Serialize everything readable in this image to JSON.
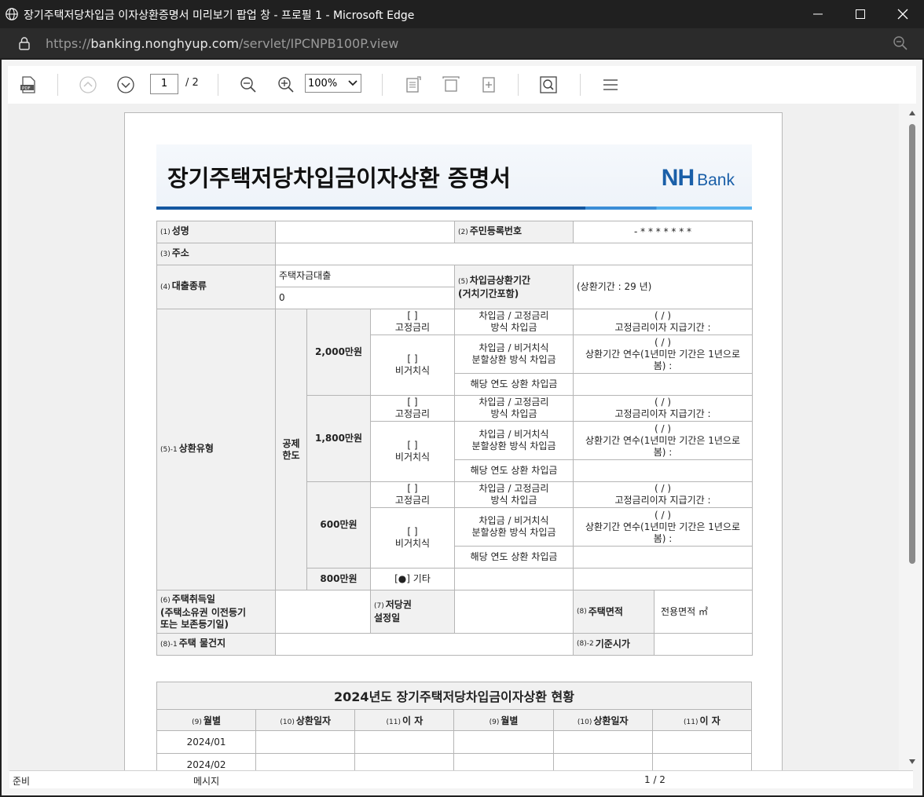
{
  "window": {
    "title": "장기주택저당차입금 이자상환증명서 미리보기 팝업 창 - 프로필 1 - Microsoft Edge",
    "url_prefix": "https://",
    "url_host": "banking.nonghyup.com",
    "url_path": "/servlet/IPCNPB100P.view"
  },
  "toolbar": {
    "page_current": "1",
    "page_total": "/ 2",
    "zoom": "100%"
  },
  "document": {
    "title": "장기주택저당차입금이자상환 증명서",
    "logo_nh": "NH",
    "logo_bank": "Bank",
    "n1": "(1)",
    "name_label": "성명",
    "n2": "(2)",
    "ssn_label": "주민등록번호",
    "ssn_value": "- * * * * * * *",
    "n3": "(3)",
    "addr_label": "주소",
    "n4": "(4)",
    "loan_type_label": "대출종류",
    "loan_type_value": "주택자금대출",
    "loan_type_value2": "0",
    "n5": "(5)",
    "period_label_1": "차입금상환기간",
    "period_label_2": "(거치기간포함)",
    "period_value": "(상환기간 : 29  년)",
    "n51": "(5)-1",
    "repay_type_label": "상환유형",
    "deduct_1": "공제",
    "deduct_2": "한도",
    "limits": [
      "2,000만원",
      "1,800만원",
      "600만원",
      "800만원"
    ],
    "bracket": "[ ]",
    "fixed": "고정금리",
    "nongrace": "비거치식",
    "fixed_desc_1": "차입금 / 고정금리",
    "fixed_desc_2": "방식 차입금",
    "nongrace_desc_1": "차입금 / 비거치식",
    "nongrace_desc_2": "분할상환 방식 차입금",
    "year_repay": "해당 연도 상환 차입금",
    "slash": "( / )",
    "fixed_period": "고정금리이자 지급기간 :",
    "nongrace_years_1": "상환기간 연수(1년미만 기간은 1년으로",
    "nongrace_years_2": "봄) :",
    "etc": "[●] 기타",
    "n6": "(6)",
    "acq_label_1": "주택취득일",
    "acq_label_2": "(주택소유권 이전등기",
    "acq_label_3": "또는 보존등기일)",
    "n7": "(7)",
    "mort_label_1": "저당권",
    "mort_label_2": "설정일",
    "n8": "(8)",
    "area_label": "주택면적",
    "area_value": "전용면적 ㎡",
    "n81": "(8)-1",
    "location_label": "주택 물건지",
    "n82": "(8)-2",
    "base_price_label": "기준시가",
    "history_title": "2024년도 장기주택저당차입금이자상환 현황",
    "hist_headers": [
      {
        "n": "(9)",
        "t": "월별"
      },
      {
        "n": "(10)",
        "t": "상환일자"
      },
      {
        "n": "(11)",
        "t": "이 자"
      },
      {
        "n": "(9)",
        "t": "월별"
      },
      {
        "n": "(10)",
        "t": "상환일자"
      },
      {
        "n": "(11)",
        "t": "이 자"
      }
    ],
    "months": [
      "2024/01",
      "2024/02"
    ]
  },
  "status": {
    "ready": "준비",
    "message": "메시지",
    "page": "1 / 2"
  }
}
